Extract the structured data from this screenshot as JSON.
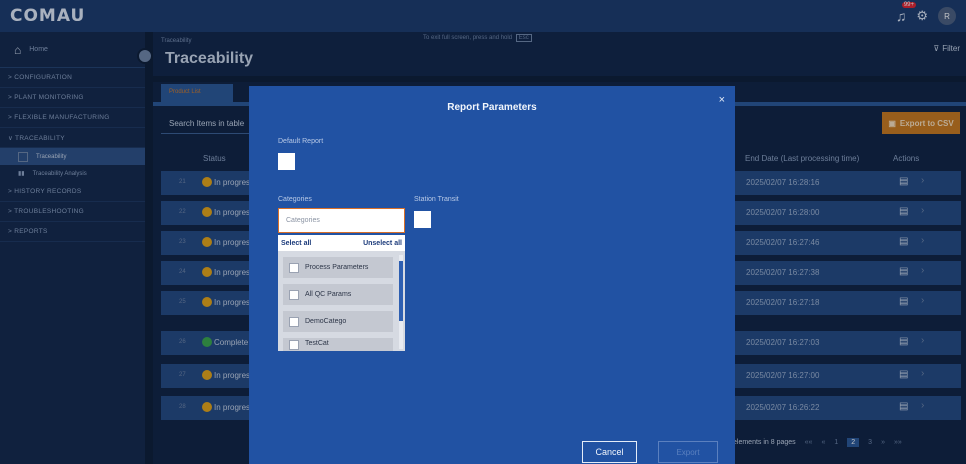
{
  "app": {
    "logo": "COMAU",
    "notif_count": "99+",
    "avatar": "R"
  },
  "sidebar": {
    "home": "Home",
    "items": [
      {
        "label": "> CONFIGURATION"
      },
      {
        "label": "> PLANT MONITORING"
      },
      {
        "label": "> FLEXIBLE MANUFACTURING"
      },
      {
        "label": "∨ TRACEABILITY"
      },
      {
        "label": "Traceability",
        "sub": true,
        "active": true
      },
      {
        "label": "Traceability Analysis",
        "sub": true
      },
      {
        "label": "> HISTORY RECORDS"
      },
      {
        "label": "> TROUBLESHOOTING"
      },
      {
        "label": "> REPORTS"
      }
    ]
  },
  "header": {
    "breadcrumb": "Traceability",
    "title": "Traceability",
    "hint": "To exit full screen, press and hold",
    "hint_key": "Esc",
    "filter": "Filter"
  },
  "content": {
    "tab": "Product List",
    "search_placeholder": "Search Items in table",
    "export_csv": "Export to CSV",
    "columns": {
      "status": "Status",
      "end_date": "End Date (Last processing time)",
      "actions": "Actions"
    },
    "rows": [
      {
        "idx": "21",
        "status": "In progress",
        "color": "#e4a316",
        "end": "2025/02/07 16:28:16"
      },
      {
        "idx": "22",
        "status": "In progress",
        "color": "#e4a316",
        "end": "2025/02/07 16:28:00"
      },
      {
        "idx": "23",
        "status": "In progress",
        "color": "#e4a316",
        "end": "2025/02/07 16:27:46"
      },
      {
        "idx": "24",
        "status": "In progress",
        "color": "#e4a316",
        "end": "2025/02/07 16:27:38"
      },
      {
        "idx": "25",
        "status": "In progress",
        "color": "#e4a316",
        "end": "2025/02/07 16:27:18"
      },
      {
        "idx": "26",
        "status": "Complete",
        "color": "#3aa64a",
        "end": "2025/02/07 16:27:03"
      },
      {
        "idx": "27",
        "status": "In progress",
        "color": "#e4a316",
        "end": "2025/02/07 16:27:00"
      },
      {
        "idx": "28",
        "status": "In progress",
        "color": "#e4a316",
        "end": "2025/02/07 16:26:22"
      }
    ],
    "pager": {
      "text": "elements in 8 pages",
      "first": "««",
      "prev": "«",
      "pages": [
        "1",
        "2",
        "3"
      ],
      "current": "2",
      "next": "»",
      "last": "»»"
    }
  },
  "modal": {
    "title": "Report Parameters",
    "close": "×",
    "default_report_label": "Default Report",
    "categories_label": "Categories",
    "categories_placeholder": "Categories",
    "station_transit_label": "Station Transit",
    "select_all": "Select all",
    "unselect_all": "Unselect all",
    "options": [
      "Process Parameters",
      "All QC Params",
      "DemoCatego",
      "TestCat"
    ],
    "cancel": "Cancel",
    "export": "Export"
  }
}
